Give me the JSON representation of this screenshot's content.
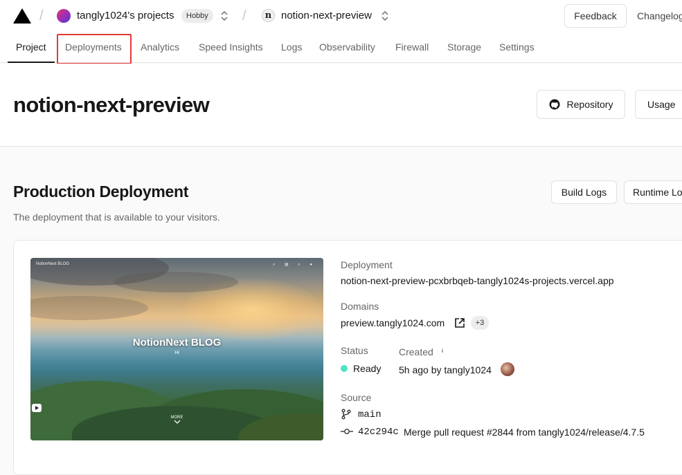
{
  "topbar": {
    "team_name": "tangly1024's projects",
    "plan_badge": "Hobby",
    "project_name": "notion-next-preview",
    "project_icon_letter": "n",
    "feedback_label": "Feedback",
    "changelog_label": "Changelog"
  },
  "tabs": [
    {
      "label": "Project",
      "active": true
    },
    {
      "label": "Deployments",
      "active": false,
      "highlighted": true
    },
    {
      "label": "Analytics",
      "active": false
    },
    {
      "label": "Speed Insights",
      "active": false
    },
    {
      "label": "Logs",
      "active": false
    },
    {
      "label": "Observability",
      "active": false
    },
    {
      "label": "Firewall",
      "active": false
    },
    {
      "label": "Storage",
      "active": false
    },
    {
      "label": "Settings",
      "active": false
    }
  ],
  "header": {
    "title": "notion-next-preview",
    "repository_label": "Repository",
    "usage_label": "Usage"
  },
  "production": {
    "title": "Production Deployment",
    "subtitle": "The deployment that is available to your visitors.",
    "build_logs_label": "Build Logs",
    "runtime_logs_label": "Runtime Logs"
  },
  "preview": {
    "brand": "NotionNext BLOG",
    "title": "NotionNext BLOG",
    "tagline": "Hi",
    "more_label": "MORE"
  },
  "deployment": {
    "deployment_label": "Deployment",
    "deployment_url": "notion-next-preview-pcxbrbqeb-tangly1024s-projects.vercel.app",
    "domains_label": "Domains",
    "domain": "preview.tangly1024.com",
    "extra_domains": "+3",
    "status_label": "Status",
    "status_value": "Ready",
    "created_label": "Created",
    "created_value": "5h ago by tangly1024",
    "source_label": "Source",
    "branch": "main",
    "commit_hash": "42c294c",
    "commit_message": "Merge pull request #2844 from tangly1024/release/4.7.5"
  },
  "colors": {
    "ready": "#50e3c2",
    "highlight": "#e53935"
  }
}
